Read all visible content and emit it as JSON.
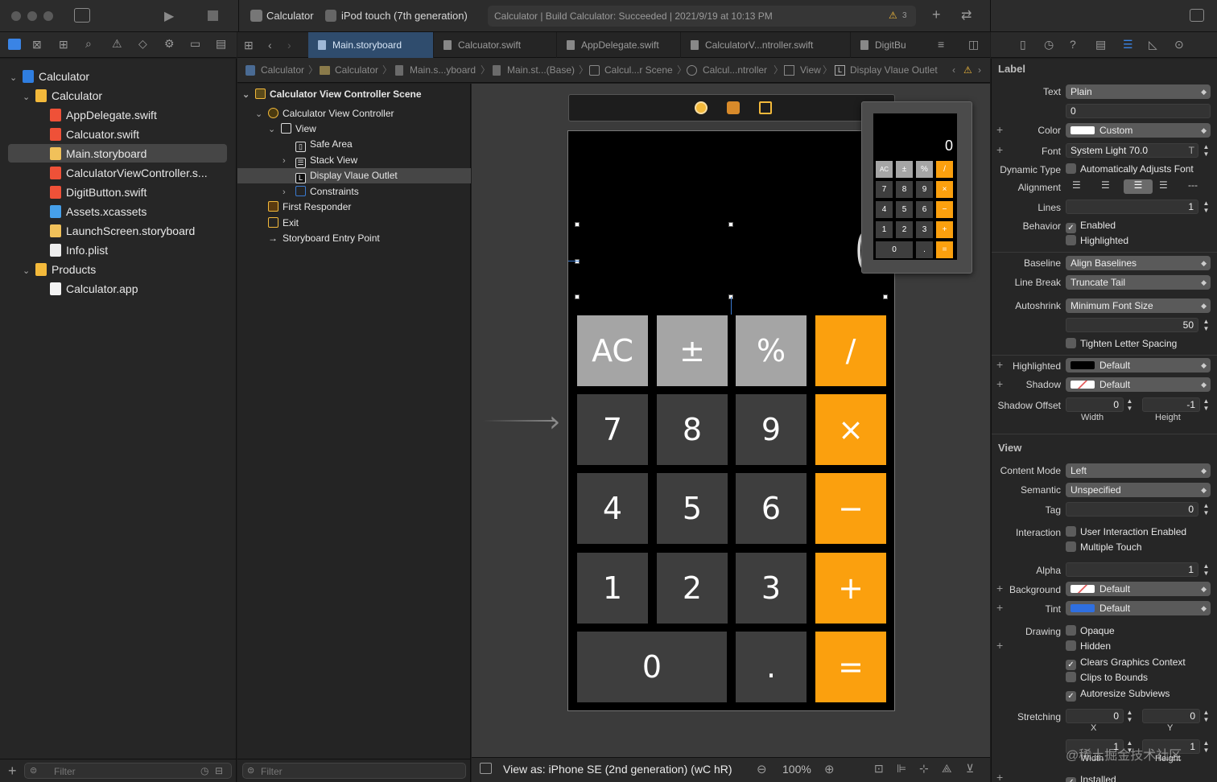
{
  "window": {
    "scheme": "Calculator",
    "device": "iPod touch (7th generation)",
    "status": "Calculator | Build Calculator: Succeeded | 2021/9/19 at 10:13 PM",
    "warning_count": "3"
  },
  "navigator": {
    "items": [
      {
        "label": "Calculator"
      },
      {
        "label": "Calculator"
      },
      {
        "label": "AppDelegate.swift"
      },
      {
        "label": "Calcuator.swift"
      },
      {
        "label": "Main.storyboard"
      },
      {
        "label": "CalculatorViewController.s..."
      },
      {
        "label": "DigitButton.swift"
      },
      {
        "label": "Assets.xcassets"
      },
      {
        "label": "LaunchScreen.storyboard"
      },
      {
        "label": "Info.plist"
      },
      {
        "label": "Products"
      },
      {
        "label": "Calculator.app"
      }
    ],
    "filter_placeholder": "Filter"
  },
  "tabs": [
    {
      "label": "Main.storyboard"
    },
    {
      "label": "Calcuator.swift"
    },
    {
      "label": "AppDelegate.swift"
    },
    {
      "label": "CalculatorV...ntroller.swift"
    },
    {
      "label": "DigitBu"
    }
  ],
  "jumpbar": [
    "Calculator",
    "Calculator",
    "Main.s...yboard",
    "Main.st...(Base)",
    "Calcul...r Scene",
    "Calcul...ntroller",
    "View",
    "Display Vlaue Outlet"
  ],
  "outline": {
    "items": [
      {
        "label": "Calculator View Controller Scene"
      },
      {
        "label": "Calculator View Controller"
      },
      {
        "label": "View"
      },
      {
        "label": "Safe Area"
      },
      {
        "label": "Stack View"
      },
      {
        "label": "Display Vlaue Outlet"
      },
      {
        "label": "Constraints"
      },
      {
        "label": "First Responder"
      },
      {
        "label": "Exit"
      },
      {
        "label": "Storyboard Entry Point"
      }
    ],
    "filter_placeholder": "Filter"
  },
  "calculator": {
    "display": "0",
    "keys": [
      [
        "AC",
        "±",
        "%",
        "/"
      ],
      [
        "7",
        "8",
        "9",
        "×"
      ],
      [
        "4",
        "5",
        "6",
        "−"
      ],
      [
        "1",
        "2",
        "3",
        "+"
      ],
      [
        "0",
        ".",
        "="
      ]
    ],
    "preview_keys": [
      [
        "AC",
        "±",
        "%",
        "/"
      ],
      [
        "7",
        "8",
        "9",
        "×"
      ],
      [
        "4",
        "5",
        "6",
        "−"
      ],
      [
        "1",
        "2",
        "3",
        "+"
      ],
      [
        "0",
        ".",
        "="
      ]
    ]
  },
  "canvas_bottom": {
    "view_as": "View as: iPhone SE (2nd generation) (wC hR)",
    "zoom": "100%"
  },
  "inspector": {
    "label_section": "Label",
    "text_label": "Text",
    "text_value": "Plain",
    "text_field": "0",
    "color_label": "Color",
    "color_value": "Custom",
    "font_label": "Font",
    "font_value": "System Light 70.0",
    "dynamic_type_label": "Dynamic Type",
    "dynamic_type_value": "Automatically Adjusts Font",
    "alignment_label": "Alignment",
    "lines_label": "Lines",
    "lines_value": "1",
    "behavior_label": "Behavior",
    "enabled": "Enabled",
    "highlighted_chk": "Highlighted",
    "baseline_label": "Baseline",
    "baseline_value": "Align Baselines",
    "line_break_label": "Line Break",
    "line_break_value": "Truncate Tail",
    "autoshrink_label": "Autoshrink",
    "autoshrink_value": "Minimum Font Size",
    "min_font_value": "50",
    "tighten": "Tighten Letter Spacing",
    "highlighted_label": "Highlighted",
    "highlighted_value": "Default",
    "shadow_label": "Shadow",
    "shadow_value": "Default",
    "shadow_offset_label": "Shadow Offset",
    "shadow_w": "0",
    "shadow_h": "-1",
    "width_caption": "Width",
    "height_caption": "Height",
    "view_section": "View",
    "content_mode_label": "Content Mode",
    "content_mode_value": "Left",
    "semantic_label": "Semantic",
    "semantic_value": "Unspecified",
    "tag_label": "Tag",
    "tag_value": "0",
    "interaction_label": "Interaction",
    "user_interaction": "User Interaction Enabled",
    "multiple_touch": "Multiple Touch",
    "alpha_label": "Alpha",
    "alpha_value": "1",
    "background_label": "Background",
    "background_value": "Default",
    "tint_label": "Tint",
    "tint_value": "Default",
    "drawing_label": "Drawing",
    "opaque": "Opaque",
    "hidden": "Hidden",
    "clears": "Clears Graphics Context",
    "clips": "Clips to Bounds",
    "autoresize": "Autoresize Subviews",
    "stretching_label": "Stretching",
    "stretch_x": "0",
    "stretch_y": "0",
    "x_caption": "X",
    "y_caption": "Y",
    "stretch_w": "1",
    "stretch_h": "1",
    "installed": "Installed",
    "watermark": "@稀土掘金技术社区"
  },
  "colors": {
    "orange": "#fba00e",
    "light_key": "#a5a5a5",
    "dark_key": "#3e3e3e",
    "selection": "#2f4c6d"
  }
}
